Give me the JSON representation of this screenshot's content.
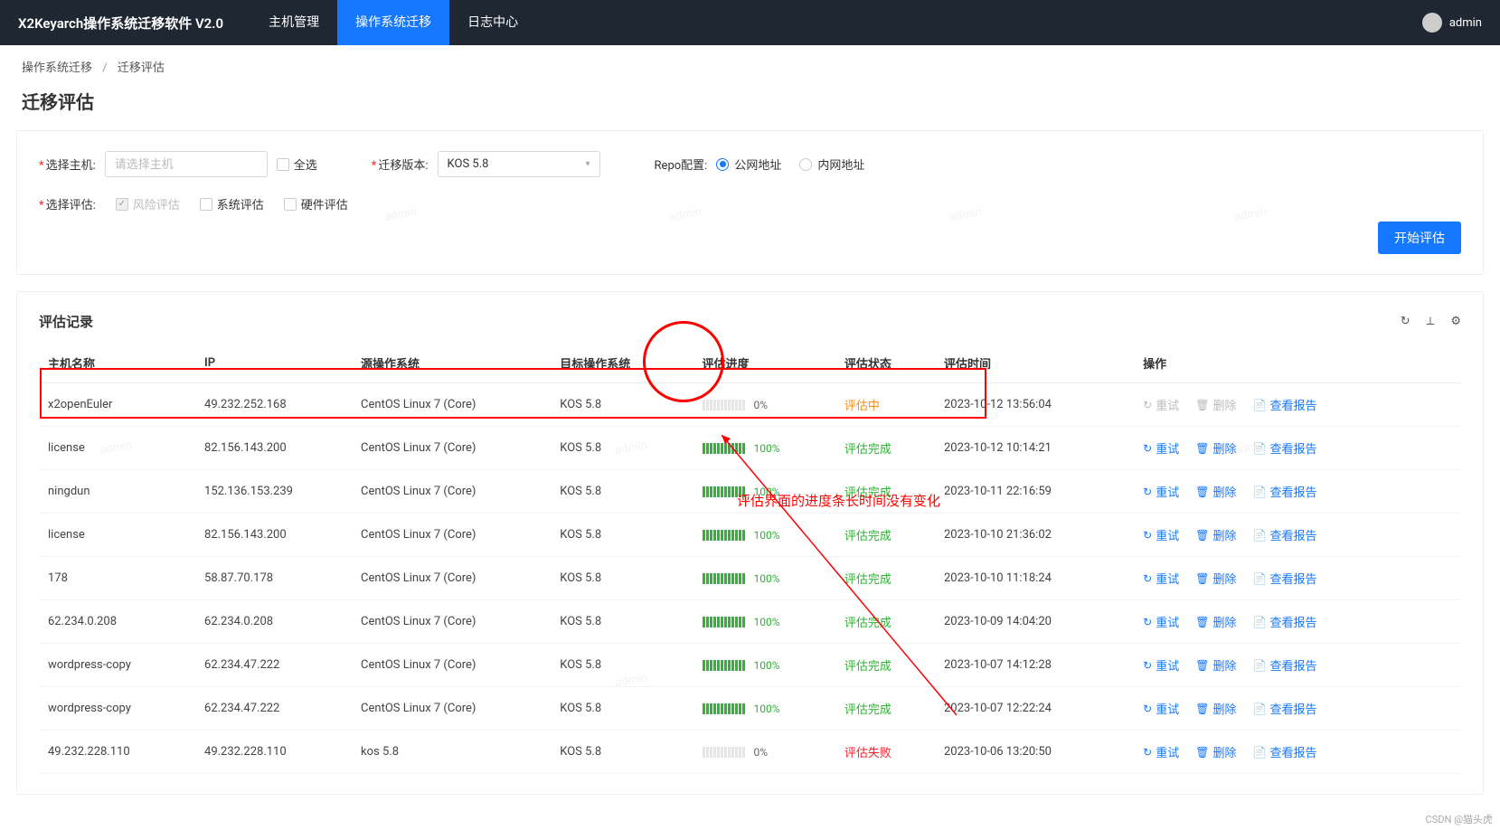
{
  "brand": "X2Keyarch操作系统迁移软件 V2.0",
  "nav": {
    "items": [
      "主机管理",
      "操作系统迁移",
      "日志中心"
    ],
    "active": 1
  },
  "user": {
    "name": "admin"
  },
  "breadcrumb": {
    "root": "操作系统迁移",
    "leaf": "迁移评估",
    "sep": "/"
  },
  "page_title": "迁移评估",
  "form": {
    "select_host_label": "选择主机:",
    "select_host_placeholder": "请选择主机",
    "all_label": "全选",
    "version_label": "迁移版本:",
    "version_value": "KOS 5.8",
    "repo_label": "Repo配置:",
    "repo_options": {
      "public": "公网地址",
      "private": "内网地址"
    },
    "eval_label": "选择评估:",
    "eval_options": {
      "risk": "风险评估",
      "system": "系统评估",
      "hardware": "硬件评估"
    },
    "start_btn": "开始评估"
  },
  "records": {
    "title": "评估记录",
    "columns": [
      "主机名称",
      "IP",
      "源操作系统",
      "目标操作系统",
      "评估进度",
      "评估状态",
      "评估时间",
      "操作"
    ],
    "actions": {
      "retry": "重试",
      "delete": "删除",
      "report": "查看报告"
    },
    "rows": [
      {
        "host": "x2openEuler",
        "ip": "49.232.252.168",
        "src": "CentOS Linux 7 (Core)",
        "dst": "KOS 5.8",
        "progress": 0,
        "status": "评估中",
        "status_cls": "doing",
        "time": "2023-10-12 13:56:04",
        "retry_disabled": true,
        "delete_disabled": true
      },
      {
        "host": "license",
        "ip": "82.156.143.200",
        "src": "CentOS Linux 7 (Core)",
        "dst": "KOS 5.8",
        "progress": 100,
        "status": "评估完成",
        "status_cls": "done",
        "time": "2023-10-12 10:14:21"
      },
      {
        "host": "ningdun",
        "ip": "152.136.153.239",
        "src": "CentOS Linux 7 (Core)",
        "dst": "KOS 5.8",
        "progress": 100,
        "status": "评估完成",
        "status_cls": "done",
        "time": "2023-10-11 22:16:59"
      },
      {
        "host": "license",
        "ip": "82.156.143.200",
        "src": "CentOS Linux 7 (Core)",
        "dst": "KOS 5.8",
        "progress": 100,
        "status": "评估完成",
        "status_cls": "done",
        "time": "2023-10-10 21:36:02"
      },
      {
        "host": "178",
        "ip": "58.87.70.178",
        "src": "CentOS Linux 7 (Core)",
        "dst": "KOS 5.8",
        "progress": 100,
        "status": "评估完成",
        "status_cls": "done",
        "time": "2023-10-10 11:18:24"
      },
      {
        "host": "62.234.0.208",
        "ip": "62.234.0.208",
        "src": "CentOS Linux 7 (Core)",
        "dst": "KOS 5.8",
        "progress": 100,
        "status": "评估完成",
        "status_cls": "done",
        "time": "2023-10-09 14:04:20"
      },
      {
        "host": "wordpress-copy",
        "ip": "62.234.47.222",
        "src": "CentOS Linux 7 (Core)",
        "dst": "KOS 5.8",
        "progress": 100,
        "status": "评估完成",
        "status_cls": "done",
        "time": "2023-10-07 14:12:28"
      },
      {
        "host": "wordpress-copy",
        "ip": "62.234.47.222",
        "src": "CentOS Linux 7 (Core)",
        "dst": "KOS 5.8",
        "progress": 100,
        "status": "评估完成",
        "status_cls": "done",
        "time": "2023-10-07 12:22:24"
      },
      {
        "host": "49.232.228.110",
        "ip": "49.232.228.110",
        "src": "kos 5.8",
        "dst": "KOS 5.8",
        "progress": 0,
        "status": "评估失败",
        "status_cls": "fail",
        "time": "2023-10-06 13:20:50"
      }
    ]
  },
  "annotation": {
    "text": "评估界面的进度条长时间没有变化"
  },
  "watermark": {
    "footer": "CSDN @猫头虎",
    "bg": "admin"
  }
}
